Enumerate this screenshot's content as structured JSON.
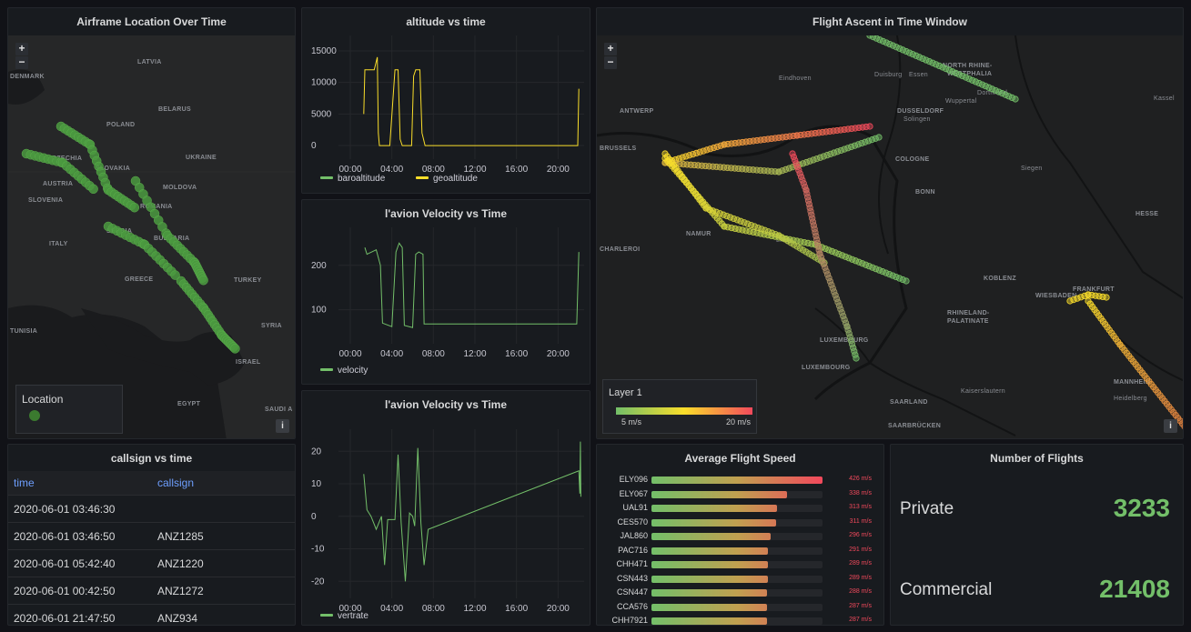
{
  "colors": {
    "green": "#73bf69",
    "yellow": "#fade2a",
    "red": "#f2495c",
    "link": "#6e9fff"
  },
  "location_panel": {
    "title": "Airframe Location Over Time",
    "legend_title": "Location",
    "zoom_in": "+",
    "zoom_out": "−",
    "info": "i",
    "map_labels": [
      "LATVIA",
      "DENMARK",
      "BELARUS",
      "POLAND",
      "CZECHIA",
      "UKRAINE",
      "SLOVAKIA",
      "AUSTRIA",
      "MOLDOVA",
      "ROMANIA",
      "SLOVENIA",
      "SERBIA",
      "BULGARIA",
      "ITALY",
      "GREECE",
      "TURKEY",
      "TUNISIA",
      "SYRIA",
      "EGYPT",
      "ISRAEL",
      "SAUDI A"
    ]
  },
  "callsign_table": {
    "title": "callsign vs time",
    "headers": [
      "time",
      "callsign"
    ],
    "rows": [
      [
        "2020-06-01 03:46:30",
        ""
      ],
      [
        "2020-06-01 03:46:50",
        "ANZ1285"
      ],
      [
        "2020-06-01 05:42:40",
        "ANZ1220"
      ],
      [
        "2020-06-01 00:42:50",
        "ANZ1272"
      ],
      [
        "2020-06-01 21:47:50",
        "ANZ934"
      ]
    ]
  },
  "chart_data": [
    {
      "type": "line",
      "title": "altitude vs time",
      "x_ticks": [
        "00:00",
        "04:00",
        "08:00",
        "12:00",
        "16:00",
        "20:00"
      ],
      "y_ticks": [
        0,
        5000,
        10000,
        15000
      ],
      "ylim": [
        -1000,
        16000
      ],
      "series": [
        {
          "name": "baroaltitude",
          "color": "#73bf69",
          "points": []
        },
        {
          "name": "geoaltitude",
          "color": "#fade2a",
          "points": [
            [
              1.3,
              5000
            ],
            [
              1.4,
              12000
            ],
            [
              2.3,
              12000
            ],
            [
              2.6,
              14000
            ],
            [
              2.7,
              2000
            ],
            [
              2.8,
              0
            ],
            [
              3.8,
              0
            ],
            [
              4.3,
              12000
            ],
            [
              4.6,
              12000
            ],
            [
              4.8,
              1000
            ],
            [
              5.0,
              0
            ],
            [
              5.9,
              0
            ],
            [
              6.1,
              11000
            ],
            [
              6.3,
              12000
            ],
            [
              6.7,
              12000
            ],
            [
              6.9,
              2000
            ],
            [
              7.2,
              0
            ],
            [
              21.9,
              0
            ],
            [
              22.0,
              9000
            ]
          ]
        }
      ]
    },
    {
      "type": "line",
      "title": "l'avion Velocity vs Time",
      "x_ticks": [
        "00:00",
        "04:00",
        "08:00",
        "12:00",
        "16:00",
        "20:00"
      ],
      "y_ticks": [
        100,
        200
      ],
      "ylim": [
        40,
        265
      ],
      "series": [
        {
          "name": "velocity",
          "color": "#73bf69",
          "points": [
            [
              1.4,
              240
            ],
            [
              1.6,
              225
            ],
            [
              2.5,
              235
            ],
            [
              2.9,
              200
            ],
            [
              3.1,
              70
            ],
            [
              4.0,
              62
            ],
            [
              4.4,
              230
            ],
            [
              4.7,
              250
            ],
            [
              5.0,
              240
            ],
            [
              5.2,
              65
            ],
            [
              6.0,
              60
            ],
            [
              6.3,
              225
            ],
            [
              6.6,
              230
            ],
            [
              7.0,
              225
            ],
            [
              7.1,
              68
            ],
            [
              21.8,
              68
            ],
            [
              22.0,
              230
            ]
          ]
        }
      ]
    },
    {
      "type": "line",
      "title": "l'avion Velocity vs Time",
      "x_ticks": [
        "00:00",
        "04:00",
        "08:00",
        "12:00",
        "16:00",
        "20:00"
      ],
      "y_ticks": [
        -20,
        -10,
        0,
        10,
        20
      ],
      "ylim": [
        -23,
        24
      ],
      "series": [
        {
          "name": "vertrate",
          "color": "#73bf69",
          "points": [
            [
              1.3,
              13
            ],
            [
              1.6,
              2
            ],
            [
              2.0,
              0
            ],
            [
              2.5,
              -4
            ],
            [
              3.0,
              0
            ],
            [
              3.3,
              -15
            ],
            [
              3.6,
              -1
            ],
            [
              4.3,
              -1
            ],
            [
              4.6,
              19
            ],
            [
              4.9,
              -2
            ],
            [
              5.3,
              -20
            ],
            [
              5.7,
              1
            ],
            [
              6.0,
              0
            ],
            [
              6.2,
              -3
            ],
            [
              6.5,
              21
            ],
            [
              6.8,
              -2
            ],
            [
              7.1,
              -15
            ],
            [
              7.5,
              -4
            ],
            [
              22.0,
              14
            ],
            [
              22.1,
              7
            ],
            [
              22.15,
              23
            ],
            [
              22.2,
              6
            ]
          ]
        }
      ]
    }
  ],
  "ascent_panel": {
    "title": "Flight Ascent in Time Window",
    "legend_title": "Layer 1",
    "legend_min": "5 m/s",
    "legend_max": "20 m/s",
    "zoom_in": "+",
    "zoom_out": "−",
    "info": "i",
    "map_labels": [
      "ANTWERP",
      "DUSSELDORF",
      "NORTH RHINE-",
      "WESTPHALIA",
      "BRUSSELS",
      "COLOGNE",
      "BONN",
      "NAMUR",
      "CHARLEROI",
      "HESSE",
      "KOBLENZ",
      "WIESBADEN",
      "FRANKFURT",
      "RHINELAND-",
      "PALATINATE",
      "LUXEMBOURG",
      "LUXEMBOURG",
      "SAARLAND",
      "SAARBRÜCKEN",
      "MANNHEIM",
      "Eindhoven",
      "Duisburg",
      "Essen",
      "Dortmund",
      "Wuppertal",
      "Solingen",
      "Siegen",
      "Liège",
      "Kassel",
      "Heidelberg",
      "Kaiserslautern"
    ]
  },
  "speed_panel": {
    "title": "Average Flight Speed",
    "max": 426,
    "rows": [
      {
        "label": "ELY096",
        "value": 426,
        "text": "426 m/s"
      },
      {
        "label": "ELY067",
        "value": 338,
        "text": "338 m/s"
      },
      {
        "label": "UAL91",
        "value": 313,
        "text": "313 m/s"
      },
      {
        "label": "CES570",
        "value": 311,
        "text": "311 m/s"
      },
      {
        "label": "JAL860",
        "value": 296,
        "text": "296 m/s"
      },
      {
        "label": "PAC716",
        "value": 291,
        "text": "291 m/s"
      },
      {
        "label": "CHH471",
        "value": 289,
        "text": "289 m/s"
      },
      {
        "label": "CSN443",
        "value": 289,
        "text": "289 m/s"
      },
      {
        "label": "CSN447",
        "value": 288,
        "text": "288 m/s"
      },
      {
        "label": "CCA576",
        "value": 287,
        "text": "287 m/s"
      },
      {
        "label": "CHH7921",
        "value": 287,
        "text": "287 m/s"
      }
    ]
  },
  "flights_panel": {
    "title": "Number of Flights",
    "private_label": "Private",
    "private_value": "3233",
    "commercial_label": "Commercial",
    "commercial_value": "21408"
  }
}
